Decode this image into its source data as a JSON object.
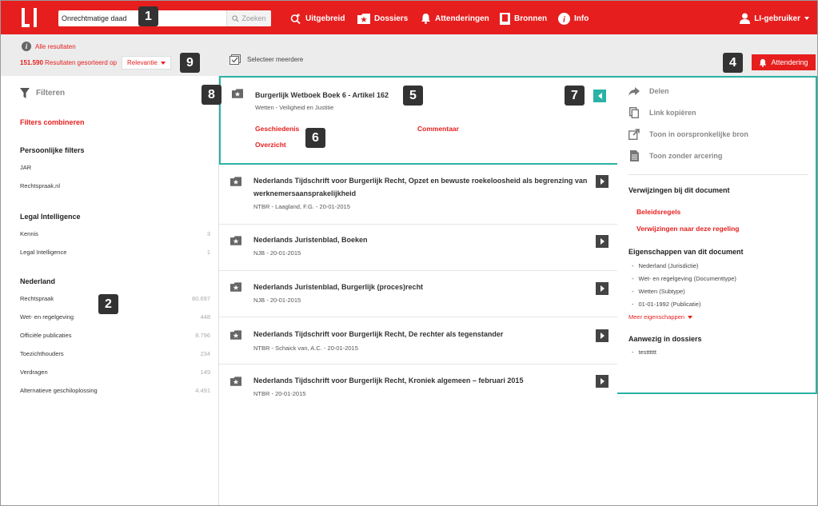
{
  "header": {
    "logo_text": "LI",
    "search_value": "Onrechtmatige daad",
    "search_button": "Zoeken",
    "nav": [
      {
        "label": "Uitgebreid",
        "icon": "search-plus-icon"
      },
      {
        "label": "Dossiers",
        "icon": "folder-star-icon"
      },
      {
        "label": "Attenderingen",
        "icon": "bell-icon"
      },
      {
        "label": "Bronnen",
        "icon": "book-icon"
      },
      {
        "label": "Info",
        "icon": "info-icon"
      }
    ],
    "user_label": "LI-gebruiker"
  },
  "subbar": {
    "all_results": "Alle resultaten",
    "results_count": "151.590",
    "results_text": "Resultaten gesorteerd op",
    "sort_value": "Relevantie",
    "select_multiple": "Selecteer meerdere",
    "alert_button": "Attendering"
  },
  "callouts": [
    "1",
    "2",
    "4",
    "5",
    "6",
    "7",
    "8",
    "9"
  ],
  "filters": {
    "header": "Filteren",
    "combine": "Filters combineren",
    "groups": [
      {
        "title": "Persoonlijke filters",
        "items": [
          {
            "label": "JAR",
            "count": ""
          },
          {
            "label": "Rechtspraak.nl",
            "count": ""
          }
        ]
      },
      {
        "title": "Legal Intelligence",
        "items": [
          {
            "label": "Kennis",
            "count": "3"
          },
          {
            "label": "Legal Intelligence",
            "count": "1"
          }
        ]
      },
      {
        "title": "Nederland",
        "items": [
          {
            "label": "Rechtspraak",
            "count": "80.697"
          },
          {
            "label": "Wet- en regelgeving",
            "count": "448"
          },
          {
            "label": "Officiële publicaties",
            "count": "8.796"
          },
          {
            "label": "Toezichthouders",
            "count": "234"
          },
          {
            "label": "Verdragen",
            "count": "149"
          },
          {
            "label": "Alternatieve geschiloplossing",
            "count": "4.491"
          }
        ]
      }
    ]
  },
  "selected_result": {
    "title": "Burgerlijk Wetboek Boek 6 - Artikel 162",
    "meta": "Wetten - Veiligheid en Justitie",
    "links": [
      "Geschiedenis",
      "Commentaar",
      "Overzicht"
    ]
  },
  "results": [
    {
      "title": "Nederlands Tijdschrift voor Burgerlijk Recht, Opzet en bewuste roekeloosheid als begrenzing van werknemersaansprakelijkheid",
      "meta": "NTBR - Laagland, F.G. - 20-01-2015"
    },
    {
      "title": "Nederlands Juristenblad, Boeken",
      "meta": "NJB - 20-01-2015"
    },
    {
      "title": "Nederlands Juristenblad, Burgerlijk (proces)recht",
      "meta": "NJB - 20-01-2015"
    },
    {
      "title": "Nederlands Tijdschrift voor Burgerlijk Recht, De rechter als tegenstander",
      "meta": "NTBR - Schaick van, A.C. - 20-01-2015"
    },
    {
      "title": "Nederlands Tijdschrift voor Burgerlijk Recht, Kroniek algemeen – februari 2015",
      "meta": "NTBR - 20-01-2015"
    }
  ],
  "side": {
    "actions": [
      {
        "label": "Delen",
        "icon": "share-arrow-icon"
      },
      {
        "label": "Link kopiëren",
        "icon": "copy-icon"
      },
      {
        "label": "Toon in oorspronkelijke bron",
        "icon": "external-link-icon"
      },
      {
        "label": "Toon zonder arcering",
        "icon": "document-icon"
      }
    ],
    "references_title": "Verwijzingen bij dit document",
    "references": [
      "Beleidsregels",
      "Verwijzingen naar deze regeling"
    ],
    "properties_title": "Eigenschappen van dit document",
    "properties": [
      "Nederland (Jurisdictie)",
      "Wet- en regelgeving (Documenttype)",
      "Wetten (Subtype)",
      "01-01-1992 (Publicatie)"
    ],
    "more_properties": "Meer eigenschappen",
    "dossiers_title": "Aanwezig in dossiers",
    "dossiers": [
      "testttttt"
    ]
  },
  "colors": {
    "brand_red": "#e61e1e",
    "teal": "#2bb2a4",
    "badge": "#333333"
  }
}
